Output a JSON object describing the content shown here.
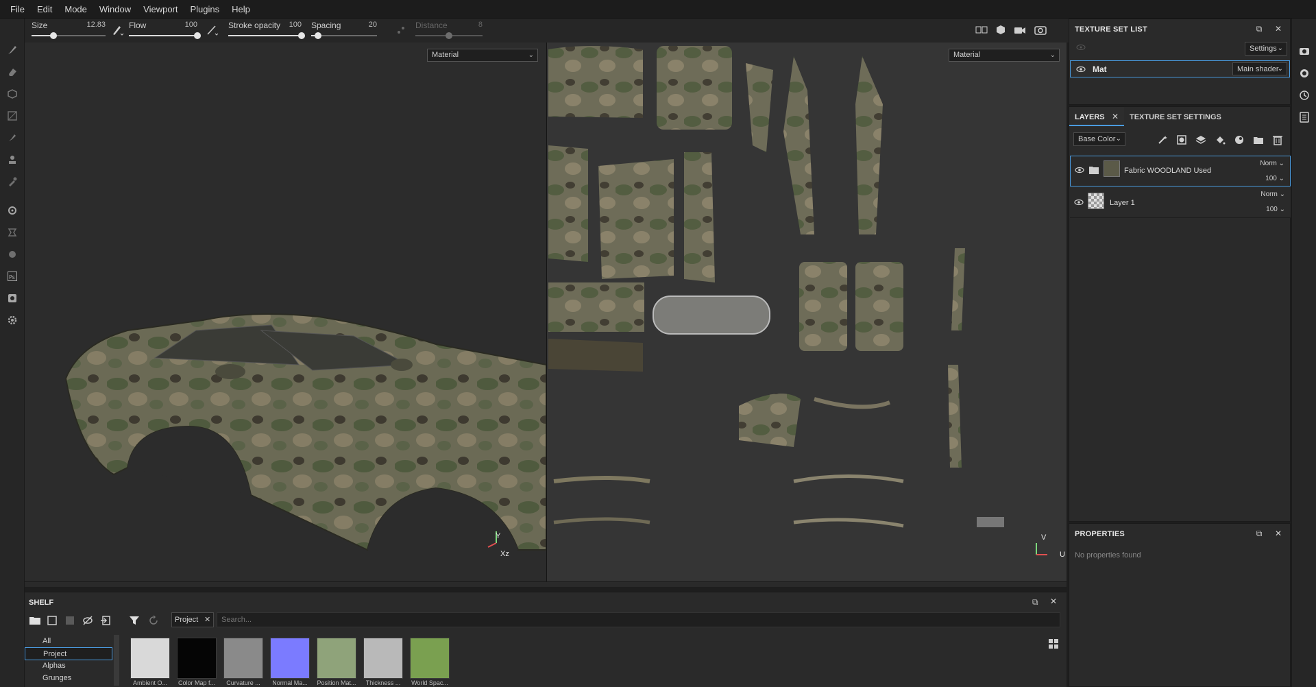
{
  "menu": [
    "File",
    "Edit",
    "Mode",
    "Window",
    "Viewport",
    "Plugins",
    "Help"
  ],
  "tool_params": {
    "size": {
      "label": "Size",
      "value": "12.83",
      "level": 0.3
    },
    "flow": {
      "label": "Flow",
      "value": "100",
      "level": 1.0
    },
    "stroke_opacity": {
      "label": "Stroke opacity",
      "value": "100",
      "level": 1.0
    },
    "spacing": {
      "label": "Spacing",
      "value": "20",
      "level": 0.1
    },
    "distance": {
      "label": "Distance",
      "value": "8",
      "level": 0.5
    }
  },
  "viewport_3d": {
    "mode": "Material",
    "axis_labels": {
      "y": "Y",
      "xz": "Xz"
    }
  },
  "viewport_2d": {
    "mode": "Material",
    "axis_labels": {
      "v": "V",
      "u": "U"
    }
  },
  "texture_set_list": {
    "title": "TEXTURE SET LIST",
    "settings_label": "Settings",
    "items": [
      {
        "name": "Mat",
        "shader": "Main shader"
      }
    ]
  },
  "layers": {
    "tabs": [
      "LAYERS",
      "TEXTURE SET SETTINGS"
    ],
    "channel": "Base Color",
    "items": [
      {
        "name": "Fabric WOODLAND Used",
        "blend": "Norm",
        "opacity": "100",
        "type": "folder"
      },
      {
        "name": "Layer 1",
        "blend": "Norm",
        "opacity": "100",
        "type": "paint"
      }
    ]
  },
  "properties": {
    "title": "PROPERTIES",
    "empty": "No properties found"
  },
  "shelf": {
    "title": "SHELF",
    "filter_tag": "Project",
    "search_placeholder": "Search...",
    "categories": [
      "All",
      "Project",
      "Alphas",
      "Grunges"
    ],
    "active_category": "Project",
    "thumbnails": [
      {
        "label": "Ambient O...",
        "color": "#d9d9d9"
      },
      {
        "label": "Color Map f...",
        "color": "#050505"
      },
      {
        "label": "Curvature ...",
        "color": "#8a8a8a"
      },
      {
        "label": "Normal Ma...",
        "color": "#7b7bff"
      },
      {
        "label": "Position Mat...",
        "color": "#8fa37a"
      },
      {
        "label": "Thickness ...",
        "color": "#b9b9b9"
      },
      {
        "label": "World Spac...",
        "color": "#7aa050"
      }
    ]
  },
  "colors": {
    "accent": "#4a9be0",
    "panel": "#2a2a2a",
    "viewport_3d": "#2c2c2c",
    "viewport_2d": "#353535"
  }
}
